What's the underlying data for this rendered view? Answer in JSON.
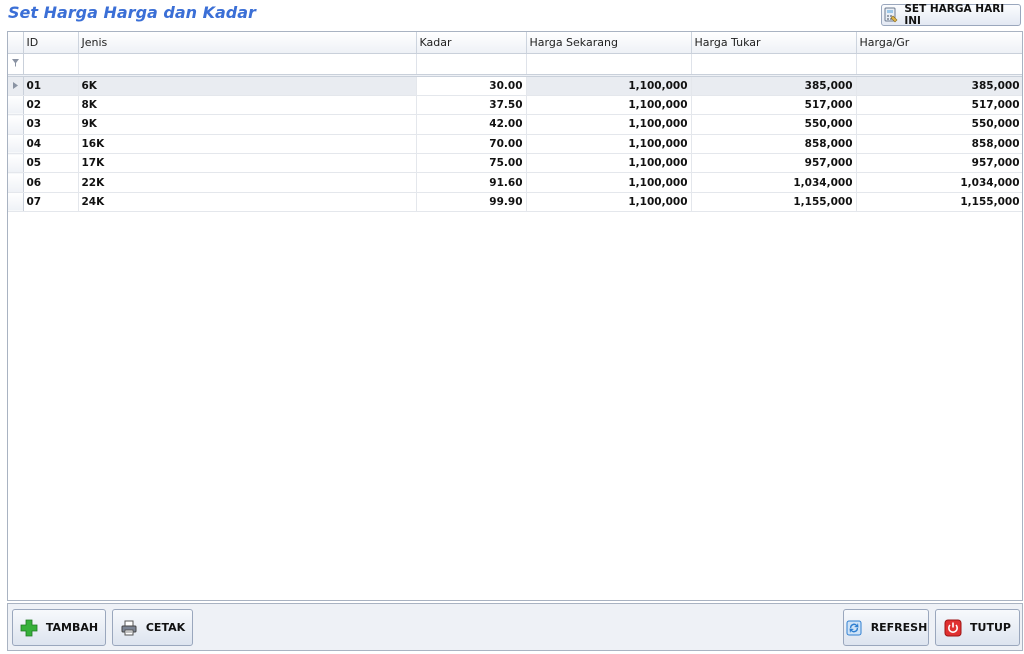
{
  "window": {
    "title": "Set Harga Harga dan Kadar"
  },
  "toolbar": {
    "set_price_label": "SET HARGA HARI INI",
    "set_price_icon": "calculator-icon"
  },
  "grid": {
    "columns": [
      "ID",
      "Jenis",
      "Kadar",
      "Harga Sekarang",
      "Harga Tukar",
      "Harga/Gr"
    ],
    "filter_icon": "filter-icon",
    "rows": [
      [
        "01",
        "6K",
        "30.00",
        "1,100,000",
        "385,000",
        "385,000"
      ],
      [
        "02",
        "8K",
        "37.50",
        "1,100,000",
        "517,000",
        "517,000"
      ],
      [
        "03",
        "9K",
        "42.00",
        "1,100,000",
        "550,000",
        "550,000"
      ],
      [
        "04",
        "16K",
        "70.00",
        "1,100,000",
        "858,000",
        "858,000"
      ],
      [
        "05",
        "17K",
        "75.00",
        "1,100,000",
        "957,000",
        "957,000"
      ],
      [
        "06",
        "22K",
        "91.60",
        "1,100,000",
        "1,034,000",
        "1,034,000"
      ],
      [
        "07",
        "24K",
        "99.90",
        "1,100,000",
        "1,155,000",
        "1,155,000"
      ]
    ],
    "selected_row": 0
  },
  "buttons": {
    "add": "TAMBAH",
    "print": "CETAK",
    "refresh": "REFRESH",
    "close": "TUTUP"
  },
  "colors": {
    "title": "#3b6fd6",
    "add_icon": "#2fa82f",
    "close_icon": "#d92b2b",
    "refresh_icon": "#2f7fd0"
  }
}
